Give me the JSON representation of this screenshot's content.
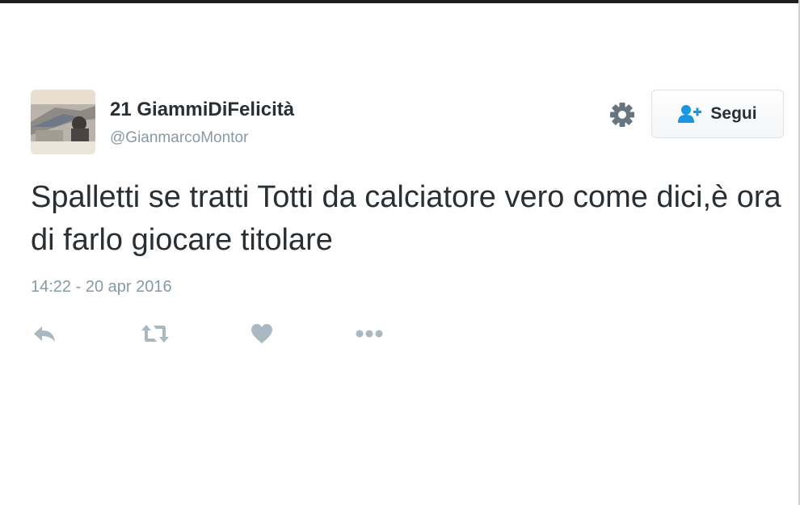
{
  "tweet": {
    "display_name": "21 GiammiDiFelicità",
    "username": "@GianmarcoMontor",
    "text": "Spalletti se tratti Totti da calciatore vero come dici,è ora di farlo giocare titolare",
    "timestamp": "14:22 - 20 apr 2016"
  },
  "header": {
    "follow_label": "Segui"
  },
  "icons": {
    "gear": "gear-icon",
    "follow": "person-add-icon",
    "reply": "reply-icon",
    "retweet": "retweet-icon",
    "like": "heart-icon",
    "more": "more-dots-icon"
  },
  "colors": {
    "text": "#292f33",
    "muted": "#8899a6",
    "accent": "#1b95e0",
    "action_icon": "#aab8c2"
  }
}
